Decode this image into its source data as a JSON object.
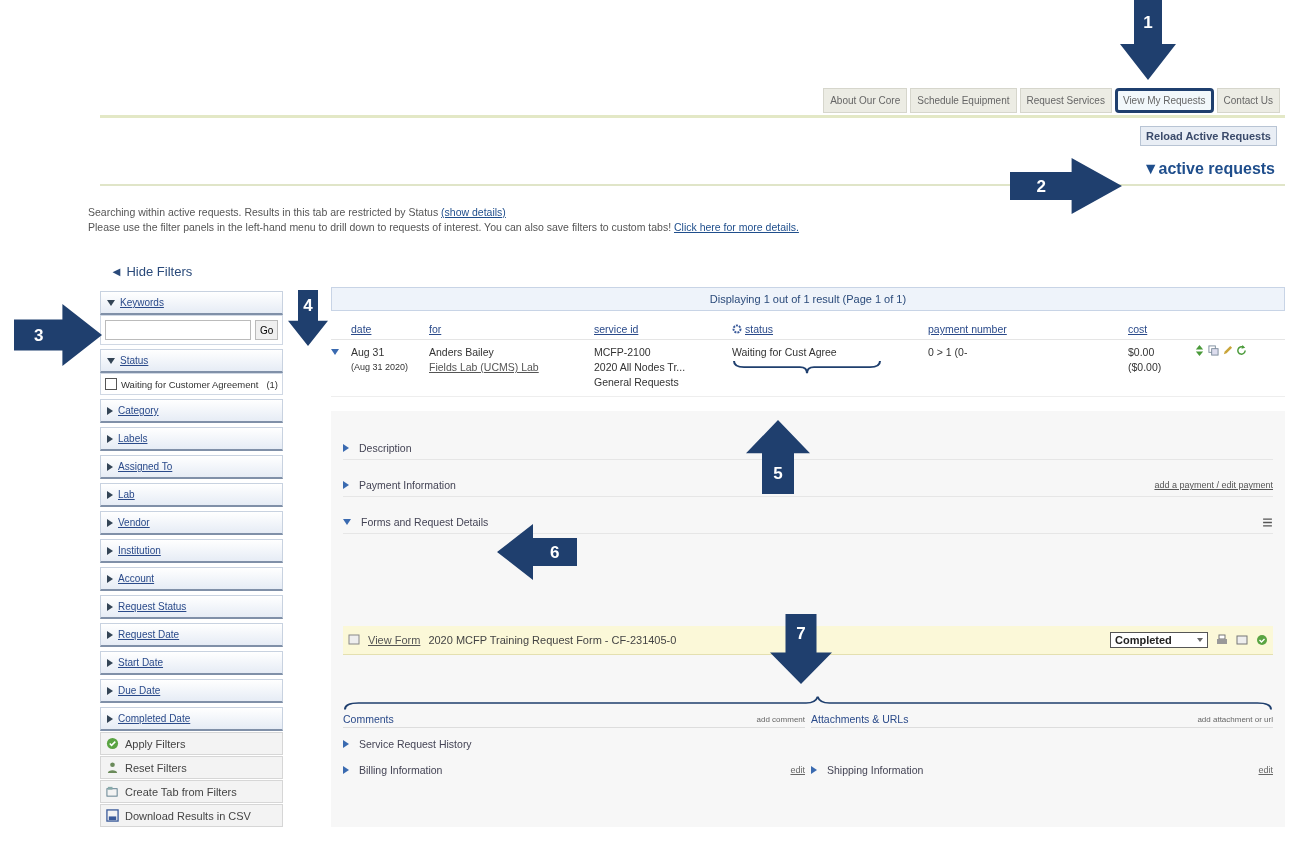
{
  "tabs": [
    {
      "label": "About Our Core",
      "selected": false
    },
    {
      "label": "Schedule Equipment",
      "selected": false
    },
    {
      "label": "Request Services",
      "selected": false
    },
    {
      "label": "View My Requests",
      "selected": true
    },
    {
      "label": "Contact Us",
      "selected": false
    }
  ],
  "reload_button": "Reload Active Requests",
  "section_title": "▼active requests",
  "notice": {
    "line_1": "Searching within active requests. Results in this tab are restricted by Status",
    "line_1_link": "(show details)",
    "line_2": "Please use the filter panels in the left-hand menu to drill down to requests of interest. You can also save filters to custom tabs!",
    "line_2_link": "Click here for more details."
  },
  "hide_filters": "◄ Hide Filters",
  "filters": [
    {
      "label": "Keywords",
      "expanded": true,
      "kind": "search",
      "button": "Go"
    },
    {
      "label": "Status",
      "expanded": true,
      "kind": "options",
      "options": [
        {
          "label": "Waiting for Customer Agreement",
          "count": "(1)",
          "checked": false
        }
      ]
    },
    {
      "label": "Category",
      "expanded": false
    },
    {
      "label": "Labels",
      "expanded": false
    },
    {
      "label": "Assigned To",
      "expanded": false
    },
    {
      "label": "Lab",
      "expanded": false
    },
    {
      "label": "Vendor",
      "expanded": false
    },
    {
      "label": "Institution",
      "expanded": false
    },
    {
      "label": "Account",
      "expanded": false
    },
    {
      "label": "Request Status",
      "expanded": false
    },
    {
      "label": "Request Date",
      "expanded": false
    },
    {
      "label": "Start Date",
      "expanded": false
    },
    {
      "label": "Due Date",
      "expanded": false
    },
    {
      "label": "Completed Date",
      "expanded": false
    }
  ],
  "filter_actions": [
    {
      "label": "Apply Filters",
      "kind": "apply"
    },
    {
      "label": "Reset Filters",
      "kind": "reset"
    },
    {
      "label": "Create Tab from Filters",
      "kind": "tab"
    },
    {
      "label": "Download Results in CSV",
      "kind": "download"
    }
  ],
  "results": {
    "summary": "Displaying 1 out of 1 result (Page 1 of 1)",
    "columns": [
      "date",
      "for",
      "service id",
      "status",
      "payment number",
      "cost"
    ],
    "rows": [
      {
        "expanded": true,
        "date": "Aug 31",
        "date_sub": "(Aug 31 2020)",
        "for": "Anders Bailey",
        "for_link": "Fields Lab (UCMS) Lab",
        "service_id": [
          "MCFP-2100",
          "2020 All Nodes Tr...",
          "General Requests"
        ],
        "status": "Waiting for Cust Agree",
        "payment": "0 > 1 (0-",
        "cost": "$0.00",
        "cost_sub": "($0.00)"
      }
    ]
  },
  "details": {
    "sections": [
      {
        "label": "Description",
        "expanded": false
      },
      {
        "label": "Payment Information",
        "expanded": false,
        "link": "add a payment / edit payment"
      },
      {
        "label": "Forms and Request Details",
        "expanded": true
      }
    ],
    "form": {
      "link": "View Form",
      "name": "2020 MCFP Training Request Form - CF-231405-0",
      "state": "Completed"
    },
    "comments": {
      "title": "Comments",
      "link": "add comment"
    },
    "attachments": {
      "title": "Attachments & URLs",
      "link": "add attachment or url"
    },
    "history": "Service Request History",
    "billing": {
      "label": "Billing Information",
      "link": "edit"
    },
    "shipping": {
      "label": "Shipping Information",
      "link": "edit"
    }
  },
  "callouts": [
    {
      "number": "1"
    },
    {
      "number": "2"
    },
    {
      "number": "3"
    },
    {
      "number": "4"
    },
    {
      "number": "5"
    },
    {
      "number": "6"
    },
    {
      "number": "7"
    }
  ]
}
